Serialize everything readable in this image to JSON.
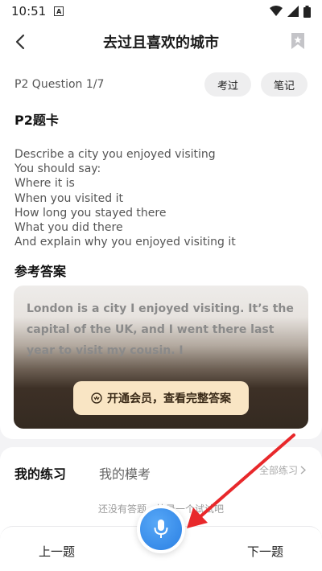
{
  "status_bar": {
    "time": "10:51",
    "notice_letter": "A"
  },
  "header": {
    "title": "去过且喜欢的城市"
  },
  "question": {
    "label": "P2 Question 1/7",
    "tags": [
      "考过",
      "笔记"
    ]
  },
  "card": {
    "title": "P2题卡",
    "lines": [
      "Describe a city you enjoyed visiting",
      "You should say:",
      "Where it is",
      "When you visited it",
      "How long you stayed there",
      "What you did there",
      "And explain why you enjoyed visiting it"
    ]
  },
  "answer": {
    "title": "参考答案",
    "preview": "London is a city I enjoyed visiting. It’s the capital of the UK, and I went there last year to visit my cousin. I",
    "unlock_label": "开通会员，查看完整答案"
  },
  "practice": {
    "tabs": [
      "我的练习",
      "我的模考"
    ],
    "all_label": "全部练习",
    "empty_text": "还没有答题，快录一个试试吧"
  },
  "bottom": {
    "prev_label": "上一题",
    "next_label": "下一题"
  },
  "colors": {
    "accent": "#2a7fe3",
    "vip_bg": "#f9e5c4",
    "annotation_arrow": "#e8282b"
  },
  "icons": [
    "back-icon",
    "bookmark-icon",
    "mic-icon",
    "wifi-icon",
    "signal-icon",
    "battery-icon",
    "vip-crown-icon",
    "chevron-right-icon"
  ]
}
